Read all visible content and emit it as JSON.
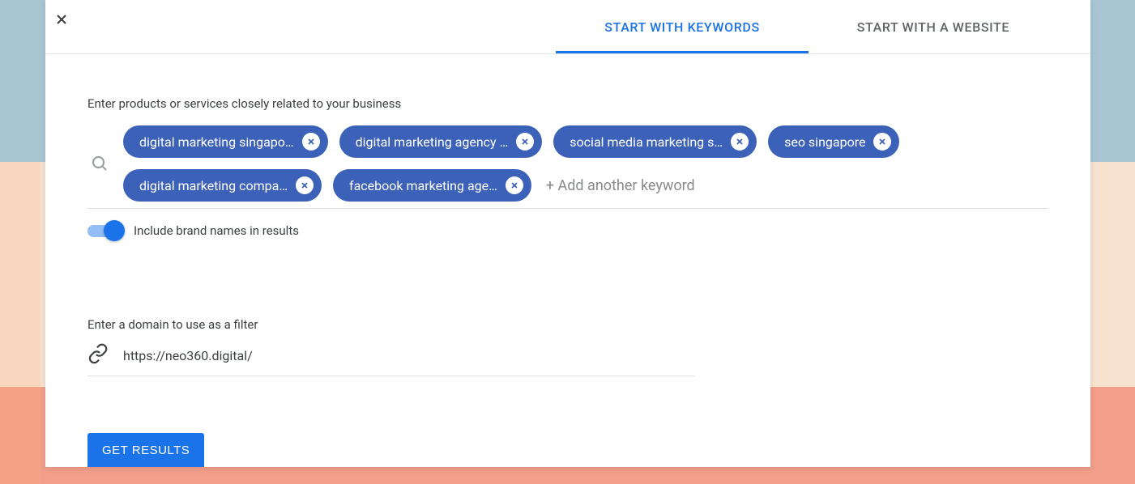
{
  "tabs": {
    "keywords": "START WITH KEYWORDS",
    "website": "START WITH A WEBSITE"
  },
  "labels": {
    "enter_products": "Enter products or services closely related to your business",
    "add_keyword": "+ Add another keyword",
    "include_brands": "Include brand names in results",
    "enter_domain": "Enter a domain to use as a filter",
    "get_results": "GET RESULTS"
  },
  "keywords": [
    "digital marketing singapo…",
    "digital marketing agency …",
    "social media marketing s…",
    "seo singapore",
    "digital marketing compa…",
    "facebook marketing age…"
  ],
  "domain_value": "https://neo360.digital/",
  "toggle_on": true
}
